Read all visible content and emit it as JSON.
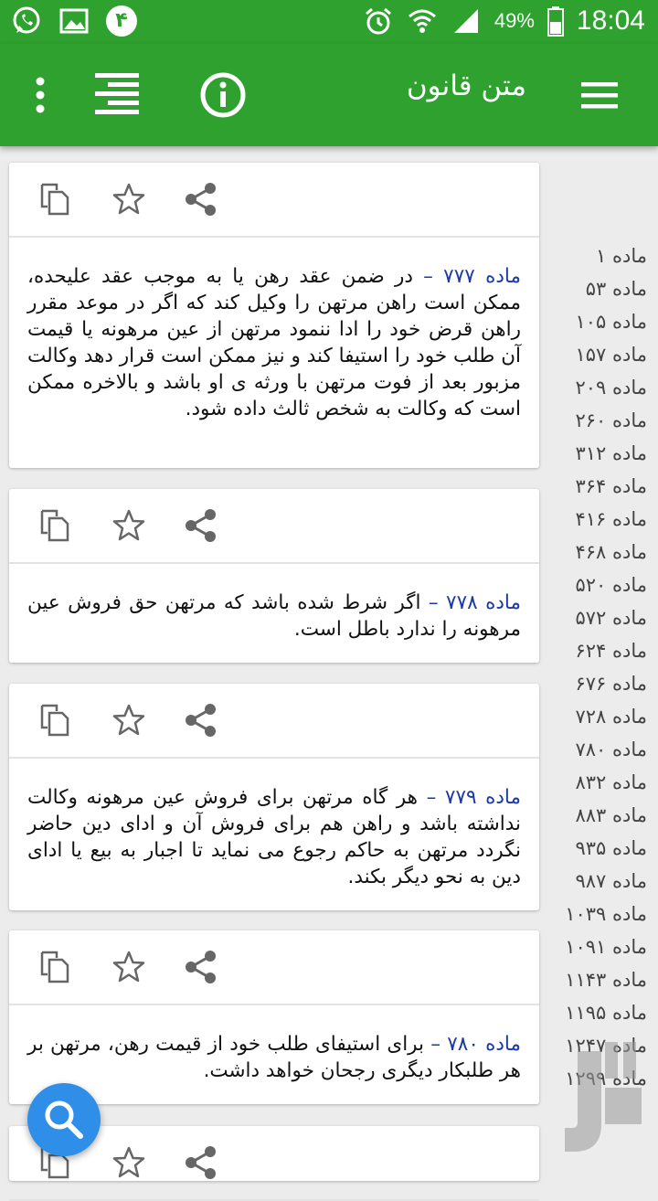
{
  "status_bar": {
    "badge": "۴",
    "battery": "49%",
    "time": "18:04"
  },
  "appbar": {
    "title": "متن قانون"
  },
  "cards": [
    {
      "label": "ماده ۷۷۷ –",
      "text": "در ضمن عقد رهن یا به موجب عقد علیحده، ممکن است راهن مرتهن را وکیل کند که اگر در موعد مقرر راهن قرض خود را ادا ننمود مرتهن از عین مرهونه یا قیمت آن طلب خود را استیفا کند و نیز ممکن است قرار دهد وکالت مزبور بعد از فوت مرتهن با ورثه ی او باشد و بالاخره ممکن است که وکالت به شخص ثالث داده شود."
    },
    {
      "label": "ماده ۷۷۸ –",
      "text": "اگر شرط شده باشد که مرتهن حق فروش عین مرهونه را ندارد باطل است."
    },
    {
      "label": "ماده ۷۷۹ –",
      "text": "هر گاه مرتهن برای فروش عین مرهونه وکالت نداشته باشد و راهن هم برای فروش آن و ادای دین حاضر نگردد مرتهن به حاکم رجوع می نماید تا اجبار به بیع یا ادای دین به نحو دیگر بکند."
    },
    {
      "label": "ماده ۷۸۰ –",
      "text": "برای استیفای طلب خود از قیمت رهن، مرتهن بر هر طلبکار دیگری رجحان خواهد داشت."
    }
  ],
  "index": [
    "ماده ۱",
    "ماده ۵۳",
    "ماده ۱۰۵",
    "ماده ۱۵۷",
    "ماده ۲۰۹",
    "ماده ۲۶۰",
    "ماده ۳۱۲",
    "ماده ۳۶۴",
    "ماده ۴۱۶",
    "ماده ۴۶۸",
    "ماده ۵۲۰",
    "ماده ۵۷۲",
    "ماده ۶۲۴",
    "ماده ۶۷۶",
    "ماده ۷۲۸",
    "ماده ۷۸۰",
    "ماده ۸۳۲",
    "ماده ۸۸۳",
    "ماده ۹۳۵",
    "ماده ۹۸۷",
    "ماده ۱۰۳۹",
    "ماده ۱۰۹۱",
    "ماده ۱۱۴۳",
    "ماده ۱۱۹۵",
    "ماده ۱۲۴۷",
    "ماده ۱۲۹۹"
  ],
  "icons": {
    "menu": "hamburger-icon",
    "info": "info-icon",
    "toc": "list-icon",
    "more": "overflow-icon",
    "copy": "copy-icon",
    "star": "star-icon",
    "share": "share-icon",
    "search": "search-icon"
  },
  "colors": {
    "primary": "#2fa12f",
    "accent_text": "#1b3aa8",
    "fab": "#2f8ee8"
  }
}
